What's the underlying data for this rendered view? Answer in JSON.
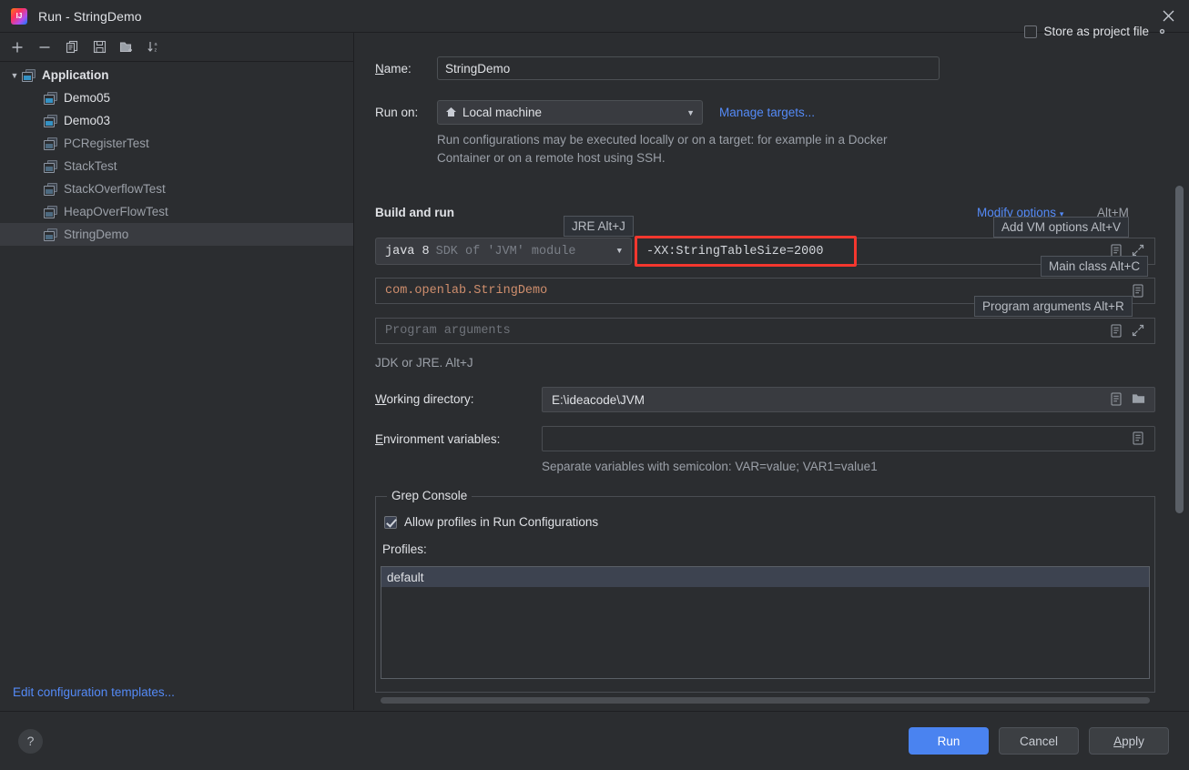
{
  "window": {
    "title": "Run - StringDemo",
    "app_icon": "intellij-idea-icon",
    "close_icon": "close-icon"
  },
  "sidebar": {
    "toolbar": [
      {
        "name": "add-configuration-button",
        "icon": "plus-icon"
      },
      {
        "name": "remove-configuration-button",
        "icon": "minus-icon"
      },
      {
        "name": "copy-configuration-button",
        "icon": "copy-icon"
      },
      {
        "name": "save-configuration-button",
        "icon": "save-icon"
      },
      {
        "name": "new-folder-button",
        "icon": "folder-plus-icon"
      },
      {
        "name": "sort-configurations-button",
        "icon": "sort-alphabetically-icon"
      }
    ],
    "group": {
      "label": "Application",
      "expanded": true
    },
    "items": [
      {
        "label": "Demo05",
        "selected": false,
        "dim": false
      },
      {
        "label": "Demo03",
        "selected": false,
        "dim": false
      },
      {
        "label": "PCRegisterTest",
        "selected": false,
        "dim": true
      },
      {
        "label": "StackTest",
        "selected": false,
        "dim": true
      },
      {
        "label": "StackOverflowTest",
        "selected": false,
        "dim": true
      },
      {
        "label": "HeapOverFlowTest",
        "selected": false,
        "dim": true
      },
      {
        "label": "StringDemo",
        "selected": true,
        "dim": true
      }
    ],
    "edit_templates_link": "Edit configuration templates..."
  },
  "form": {
    "name_label": "Name:",
    "name_value": "StringDemo",
    "store_as_project_file": {
      "label": "Store as project file",
      "checked": false
    },
    "run_on_label": "Run on:",
    "run_on_value": "Local machine",
    "manage_targets_link": "Manage targets...",
    "run_on_hint": "Run configurations may be executed locally or on a target: for example in a Docker Container or on a remote host using SSH.",
    "build_and_run_title": "Build and run",
    "modify_options_link": "Modify options",
    "modify_options_shortcut": "Alt+M",
    "sdk_version": "java 8",
    "sdk_module": "SDK of 'JVM' module",
    "vm_options_value": "-XX:StringTableSize=2000",
    "main_class_value": "com.openlab.StringDemo",
    "program_arguments_placeholder": "Program arguments",
    "jdk_hint": "JDK or JRE. Alt+J",
    "working_directory_label": "Working directory:",
    "working_directory_value": "E:\\ideacode\\JVM",
    "environment_variables_label": "Environment variables:",
    "environment_variables_value": "",
    "environment_hint": "Separate variables with semicolon: VAR=value; VAR1=value1"
  },
  "tooltips": [
    {
      "id": "jre",
      "text": "JRE Alt+J",
      "mnemonic": "J"
    },
    {
      "id": "vm",
      "text": "Add VM options Alt+V",
      "mnemonic": "V"
    },
    {
      "id": "main",
      "text": "Main class Alt+C",
      "mnemonic": "C"
    },
    {
      "id": "args",
      "text": "Program arguments Alt+R",
      "mnemonic": "R"
    }
  ],
  "grep_console": {
    "group_title": "Grep Console",
    "allow_profiles_label": "Allow profiles in Run Configurations",
    "allow_profiles_checked": true,
    "profiles_label": "Profiles:",
    "profiles": [
      {
        "label": "default",
        "selected": true
      }
    ]
  },
  "footer": {
    "help_label": "?",
    "run_label": "Run",
    "cancel_label": "Cancel",
    "apply_label": "Apply"
  },
  "colors": {
    "background": "#2b2d30",
    "accent_link": "#548af7",
    "primary_button": "#4a83f0",
    "annotation_red": "#f4372e",
    "code_orange": "#cf8e6d"
  }
}
